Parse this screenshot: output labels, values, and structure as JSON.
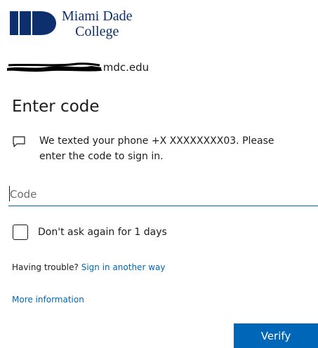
{
  "logo": {
    "line1": "Miami Dade",
    "line2": "College",
    "color": "#0e2f6d"
  },
  "identity": {
    "visible_suffix": ".mdc.edu"
  },
  "title": "Enter code",
  "message": {
    "icon": "chat-message-icon",
    "text": "We texted your phone +X XXXXXXXX03. Please\nenter the code to sign in."
  },
  "code_field": {
    "placeholder": "Code",
    "value": ""
  },
  "remember": {
    "label": "Don't ask again for 1 days",
    "checked": false
  },
  "trouble": {
    "prefix": "Having trouble?",
    "link": "Sign in another way"
  },
  "more_info": "More information",
  "verify_button": "Verify",
  "colors": {
    "accent": "#0067b8",
    "text": "#1b1b1b"
  }
}
